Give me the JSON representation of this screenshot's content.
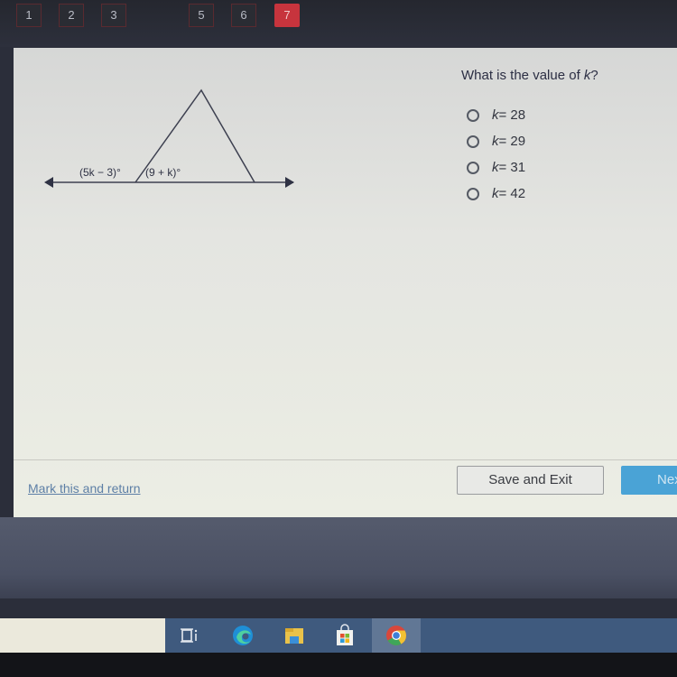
{
  "nav": {
    "questions": [
      {
        "label": "1",
        "active": false
      },
      {
        "label": "2",
        "active": false
      },
      {
        "label": "3",
        "active": false
      },
      {
        "label": "5",
        "active": false
      },
      {
        "label": "6",
        "active": false
      },
      {
        "label": "7",
        "active": true
      }
    ],
    "active_color": "#c7343d"
  },
  "figure": {
    "angle_left": "(5k − 3)°",
    "angle_right": "(9 + k)°"
  },
  "question": {
    "prefix": "What is the value of ",
    "variable": "k",
    "suffix": "?"
  },
  "options": [
    {
      "var": "k",
      "text": " = 28"
    },
    {
      "var": "k",
      "text": " = 29"
    },
    {
      "var": "k",
      "text": " = 31"
    },
    {
      "var": "k",
      "text": " = 42"
    }
  ],
  "footer": {
    "mark_link": "Mark this and return",
    "save_exit": "Save and Exit",
    "next": "Next",
    "next_color": "#4aa3d6"
  },
  "taskbar": {
    "icons": [
      "task-view-icon",
      "edge-icon",
      "file-explorer-icon",
      "store-icon",
      "chrome-icon"
    ],
    "active_icon": "chrome-icon"
  }
}
